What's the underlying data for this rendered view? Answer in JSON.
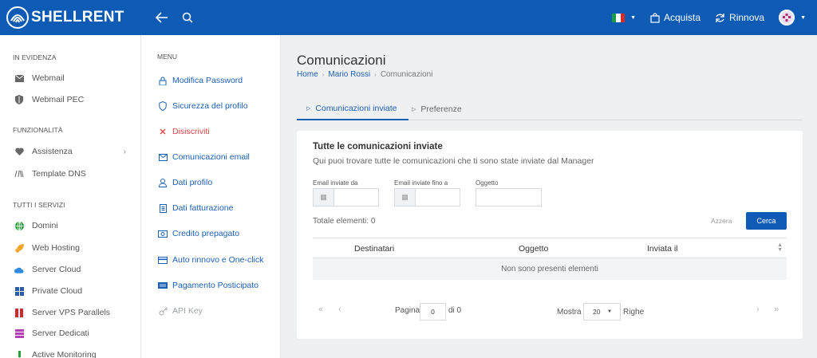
{
  "topbar": {
    "brand": "SHELLRENT",
    "purchase_label": "Acquista",
    "renew_label": "Rinnova"
  },
  "sidebar": {
    "sections": [
      {
        "title": "IN EVIDENZA",
        "items": [
          {
            "label": "Webmail",
            "icon": "envelope-icon"
          },
          {
            "label": "Webmail PEC",
            "icon": "shield-icon"
          }
        ]
      },
      {
        "title": "FUNZIONALITÀ",
        "items": [
          {
            "label": "Assistenza",
            "icon": "heart-icon",
            "has_submenu": true
          },
          {
            "label": "Template DNS",
            "icon": "dns-icon"
          }
        ]
      },
      {
        "title": "TUTTI I SERVIZI",
        "items": [
          {
            "label": "Domini",
            "icon": "globe-icon",
            "color": "#2a9d3a"
          },
          {
            "label": "Web Hosting",
            "icon": "rocket-icon",
            "color": "#f5a524"
          },
          {
            "label": "Server Cloud",
            "icon": "cloud-icon",
            "color": "#2f8be0"
          },
          {
            "label": "Private Cloud",
            "icon": "grid-icon",
            "color": "#2a5caa"
          },
          {
            "label": "Server VPS Parallels",
            "icon": "parallels-icon",
            "color": "#d4272d"
          },
          {
            "label": "Server Dedicati",
            "icon": "server-icon",
            "color": "#b43fb8"
          },
          {
            "label": "Active Monitoring",
            "icon": "monitor-icon",
            "color": "#2a9d3a"
          }
        ]
      }
    ]
  },
  "menu": {
    "title": "MENU",
    "items": [
      {
        "label": "Modifica Password",
        "icon": "lock-icon"
      },
      {
        "label": "Sicurezza del profilo",
        "icon": "shield-icon"
      },
      {
        "label": "Disiscriviti",
        "icon": "close-icon"
      },
      {
        "label": "Comunicazioni email",
        "icon": "envelope-icon"
      },
      {
        "label": "Dati profilo",
        "icon": "user-icon"
      },
      {
        "label": "Dati fatturazione",
        "icon": "invoice-icon"
      },
      {
        "label": "Credito prepagato",
        "icon": "money-icon"
      },
      {
        "label": "Auto rinnovo e One-click",
        "icon": "credit-card-icon"
      },
      {
        "label": "Pagamento Posticipato",
        "icon": "visa-icon"
      },
      {
        "label": "API Key",
        "icon": "key-icon"
      }
    ]
  },
  "main": {
    "title": "Comunicazioni",
    "breadcrumb": [
      "Home",
      "Mario Rossi",
      "Comunicazioni"
    ],
    "tabs": [
      "Comunicazioni inviate",
      "Preferenze"
    ],
    "card": {
      "title": "Tutte le comunicazioni inviate",
      "subtitle": "Qui puoi trovare tutte le comunicazioni che ti sono state inviate dal Manager",
      "filter_from_label": "Email inviate da",
      "filter_to_label": "Email inviate fino a",
      "filter_subject_label": "Oggetto",
      "total_label": "Totale elementi: 0",
      "reset_label": "Azzera",
      "search_label": "Cerca",
      "columns": [
        "Destinatari",
        "Oggetto",
        "Inviata il"
      ],
      "empty_message": "Non sono presenti elementi",
      "pagination": {
        "page_label": "Pagina",
        "page_value": "0",
        "of_label": "di 0",
        "show_label": "Mostra",
        "page_size": "20",
        "rows_label": "Righe"
      }
    }
  },
  "colors": {
    "primary": "#0e5bb5",
    "link": "#1c5fb4",
    "danger": "#e04646"
  }
}
